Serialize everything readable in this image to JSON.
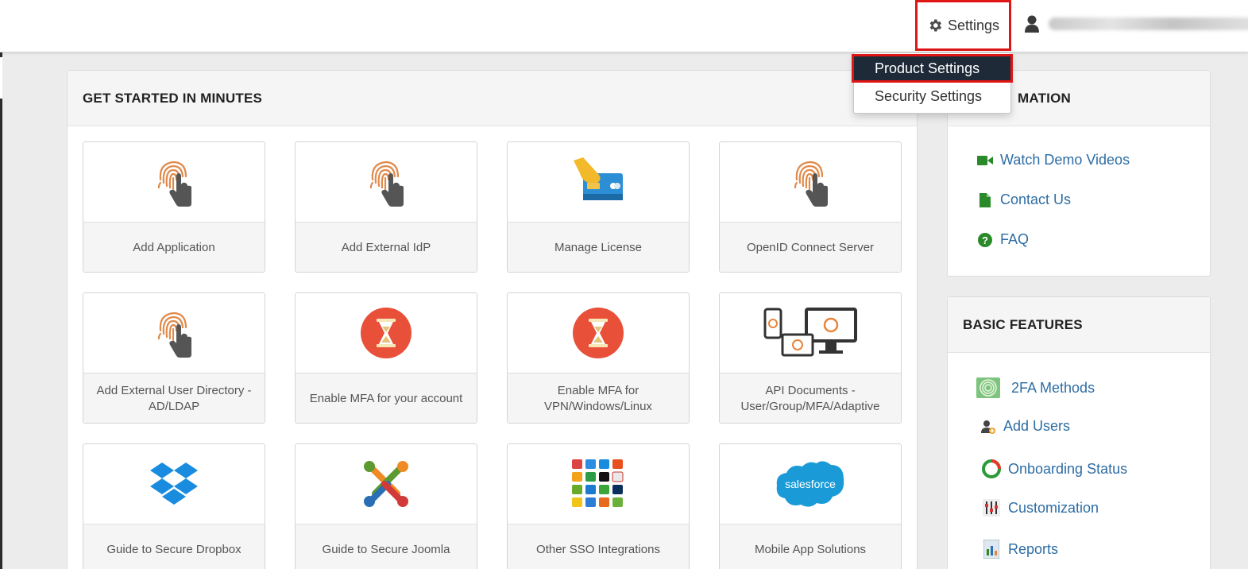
{
  "header": {
    "settings_label": "Settings",
    "settings_icon": "gear-icon",
    "user_icon": "user-icon"
  },
  "settings_menu": {
    "items": [
      {
        "label": "Product Settings",
        "active": true
      },
      {
        "label": "Security Settings",
        "active": false
      }
    ]
  },
  "get_started": {
    "title": "GET STARTED IN MINUTES",
    "tiles": [
      {
        "label": "Add Application",
        "icon": "fingerprint-icon"
      },
      {
        "label": "Add External IdP",
        "icon": "fingerprint-icon"
      },
      {
        "label": "Manage License",
        "icon": "credit-card-icon"
      },
      {
        "label": "OpenID Connect Server",
        "icon": "fingerprint-icon"
      },
      {
        "label": "Add External User Directory - AD/LDAP",
        "icon": "fingerprint-icon"
      },
      {
        "label": "Enable MFA for your account",
        "icon": "hourglass-icon"
      },
      {
        "label": "Enable MFA for VPN/Windows/Linux",
        "icon": "hourglass-icon"
      },
      {
        "label": "API Documents - User/Group/MFA/Adaptive",
        "icon": "devices-icon"
      },
      {
        "label": "Guide to Secure Dropbox",
        "icon": "dropbox-icon"
      },
      {
        "label": "Guide to Secure Joomla",
        "icon": "joomla-icon"
      },
      {
        "label": "Other SSO Integrations",
        "icon": "app-grid-icon"
      },
      {
        "label": "Mobile App Solutions",
        "icon": "salesforce-icon"
      }
    ]
  },
  "information": {
    "title": "MATION",
    "links": [
      {
        "label": "Watch Demo Videos",
        "icon": "video-camera-icon"
      },
      {
        "label": "Contact Us",
        "icon": "document-icon"
      },
      {
        "label": "FAQ",
        "icon": "question-circle-icon"
      }
    ]
  },
  "basic_features": {
    "title": "BASIC FEATURES",
    "links": [
      {
        "label": "2FA Methods",
        "icon": "fingerprint-badge-icon"
      },
      {
        "label": "Add Users",
        "icon": "add-user-icon"
      },
      {
        "label": "Onboarding Status",
        "icon": "donut-status-icon"
      },
      {
        "label": "Customization",
        "icon": "sliders-icon"
      },
      {
        "label": "Reports",
        "icon": "report-icon"
      }
    ]
  },
  "colors": {
    "highlight_border": "#e01515",
    "menu_active_bg": "#1e2a38",
    "link": "#2e6da4",
    "icon_green": "#2a8a2a",
    "mfa_red": "#e8503a"
  }
}
